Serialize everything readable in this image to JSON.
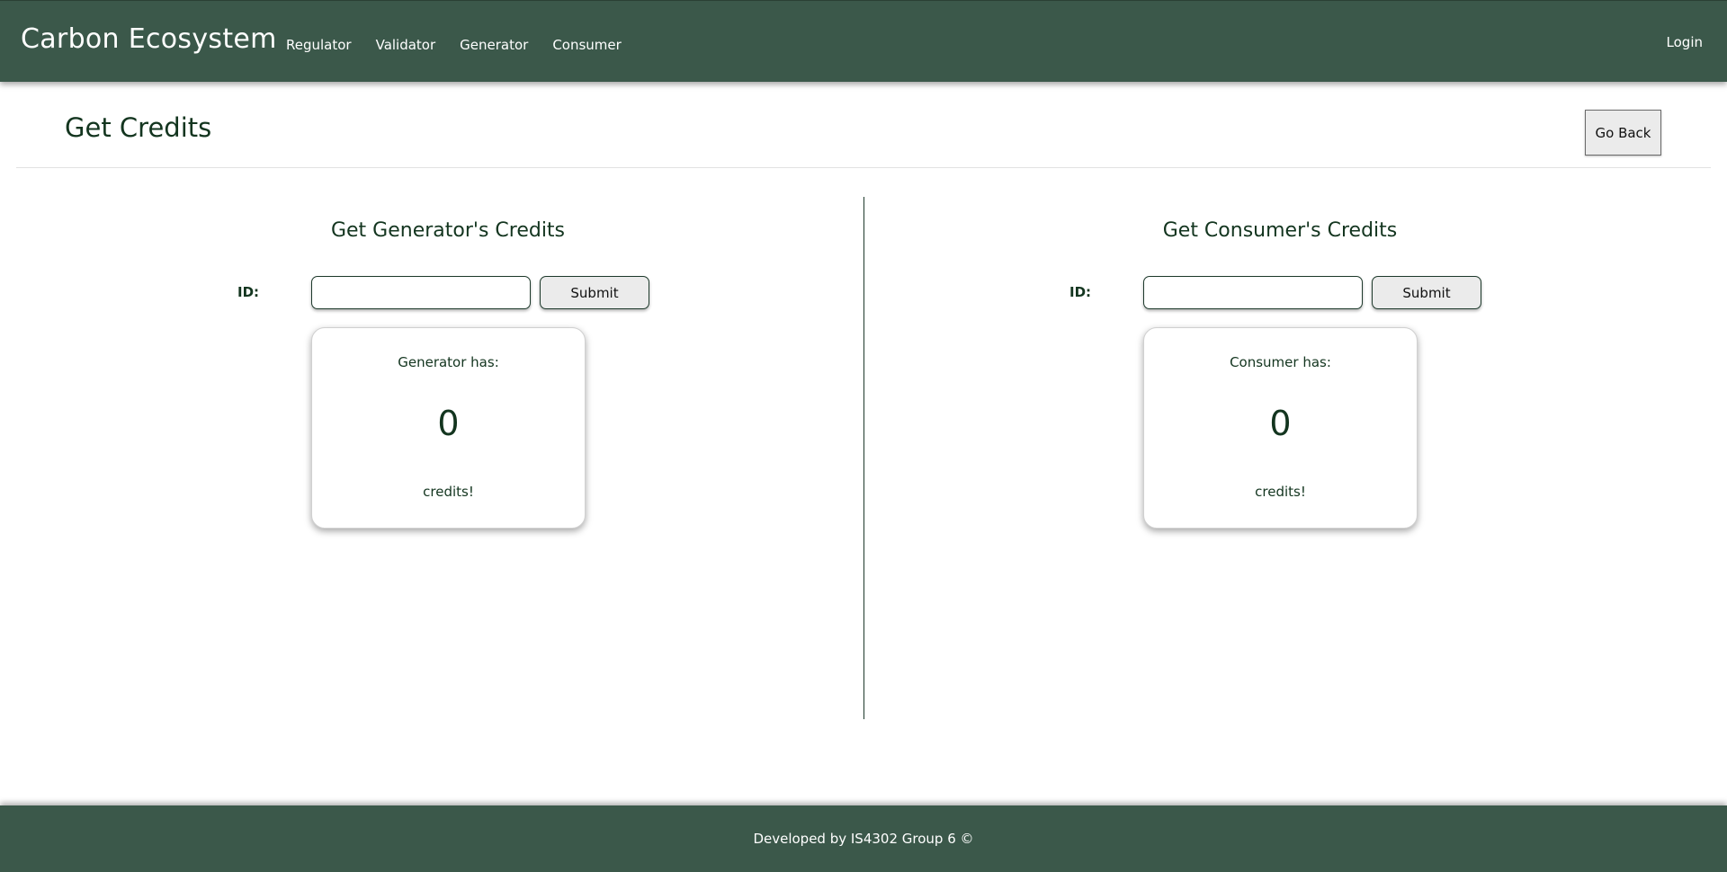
{
  "navbar": {
    "brand": "Carbon Ecosystem",
    "links": [
      "Regulator",
      "Validator",
      "Generator",
      "Consumer"
    ],
    "login": "Login",
    "background_color": "#3b584a"
  },
  "page": {
    "title": "Get Credits",
    "go_back_label": "Go Back"
  },
  "generator_panel": {
    "title": "Get Generator's Credits",
    "id_label": "ID:",
    "id_value": "",
    "submit_label": "Submit",
    "card": {
      "label": "Generator has:",
      "value": "0",
      "suffix": "credits!"
    }
  },
  "consumer_panel": {
    "title": "Get Consumer's Credits",
    "id_label": "ID:",
    "id_value": "",
    "submit_label": "Submit",
    "card": {
      "label": "Consumer has:",
      "value": "0",
      "suffix": "credits!"
    }
  },
  "footer": {
    "text": "Developed by IS4302 Group 6 ©"
  },
  "colors": {
    "header_footer": "#3b584a",
    "text_primary": "#13351f",
    "button_bg": "#ebebeb"
  }
}
